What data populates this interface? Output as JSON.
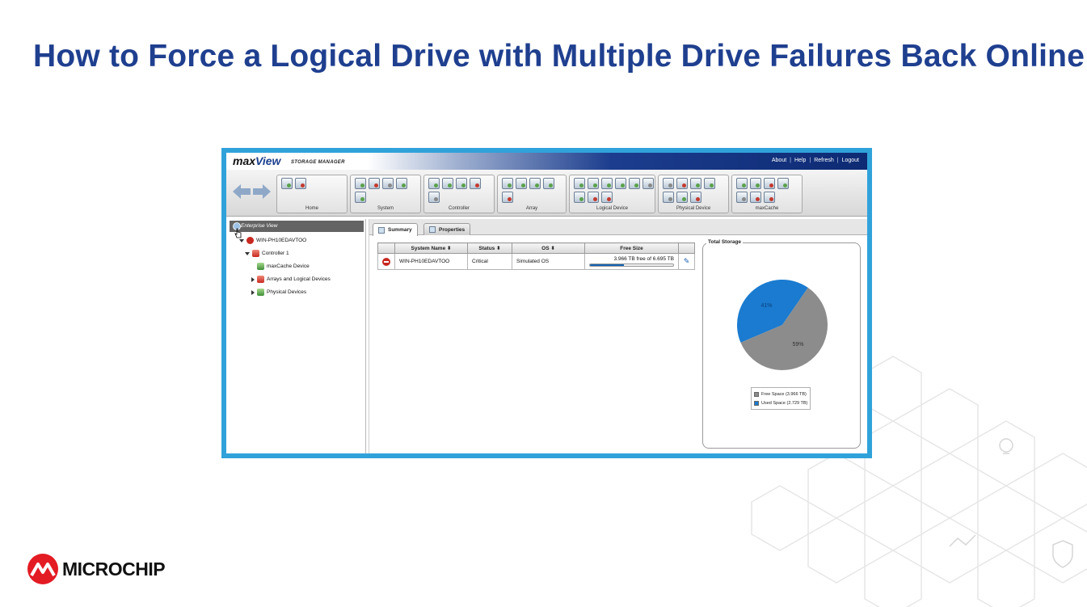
{
  "slide": {
    "title": "How to Force a Logical Drive with Multiple Drive Failures Back Online",
    "logo_text": "MICROCHIP"
  },
  "app": {
    "brand_prefix": "max",
    "brand_suffix": "View",
    "brand_sub": "STORAGE MANAGER",
    "top_links": [
      "About",
      "Help",
      "Refresh",
      "Logout"
    ],
    "toolbar_groups": [
      {
        "label": "Home",
        "icons": 2
      },
      {
        "label": "System",
        "icons": 5
      },
      {
        "label": "Controller",
        "icons": 5
      },
      {
        "label": "Array",
        "icons": 5
      },
      {
        "label": "Logical Device",
        "icons": 9
      },
      {
        "label": "Physical Device",
        "icons": 7
      },
      {
        "label": "maxCache",
        "icons": 7
      }
    ]
  },
  "tree": {
    "header": "Enterprise View",
    "nodes": [
      {
        "label": "WIN-PH10EDAVTOO",
        "level": 1
      },
      {
        "label": "Controller 1",
        "level": 2
      },
      {
        "label": "maxCache Device",
        "level": 3
      },
      {
        "label": "Arrays and Logical Devices",
        "level": 3
      },
      {
        "label": "Physical Devices",
        "level": 3
      }
    ]
  },
  "tabs": [
    {
      "label": "Summary",
      "active": true
    },
    {
      "label": "Properties",
      "active": false
    }
  ],
  "table": {
    "headers": [
      "System Name",
      "Status",
      "OS",
      "Free Size"
    ],
    "row": {
      "system_name": "WIN-PH10EDAVTOO",
      "status": "Critical",
      "os": "Simulated OS",
      "free_size": "3.966 TB free of 6.695 TB",
      "used_fraction": 0.41
    }
  },
  "storage": {
    "title": "Total Storage",
    "slices": [
      {
        "label": "59%",
        "value": 59,
        "color": "#8c8c8c",
        "legend": "Free Space (3.966 TB)"
      },
      {
        "label": "41%",
        "value": 41,
        "color": "#1a7bd0",
        "legend": "Used Space (2.729 TB)"
      }
    ]
  },
  "colors": {
    "title": "#1f3f8f",
    "frame": "#30a2da",
    "critical": "#c8281f"
  }
}
